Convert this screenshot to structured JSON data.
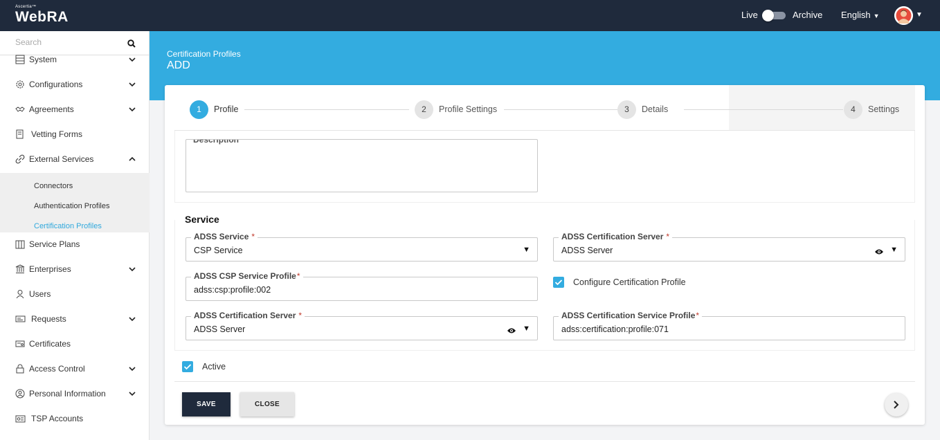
{
  "app": {
    "brand_small": "Ascertia™",
    "name": "WebRA"
  },
  "header": {
    "live_label": "Live",
    "archive_label": "Archive",
    "language": "English",
    "avatar_icon": "user-avatar-icon"
  },
  "sidebar": {
    "search_placeholder": "Search",
    "items": [
      {
        "label": "System",
        "icon": "server-icon",
        "expandable": true
      },
      {
        "label": "Configurations",
        "icon": "gear-icon",
        "expandable": true
      },
      {
        "label": "Agreements",
        "icon": "handshake-icon",
        "expandable": true
      },
      {
        "label": "Vetting Forms",
        "icon": "form-icon",
        "expandable": false
      },
      {
        "label": "External Services",
        "icon": "link-icon",
        "expandable": true,
        "expanded": true
      },
      {
        "label": "Service Plans",
        "icon": "plan-icon",
        "expandable": false
      },
      {
        "label": "Enterprises",
        "icon": "bank-icon",
        "expandable": true
      },
      {
        "label": "Users",
        "icon": "user-icon",
        "expandable": false
      },
      {
        "label": "Requests",
        "icon": "requests-icon",
        "expandable": true
      },
      {
        "label": "Certificates",
        "icon": "certificate-icon",
        "expandable": false
      },
      {
        "label": "Access Control",
        "icon": "lock-icon",
        "expandable": true
      },
      {
        "label": "Personal Information",
        "icon": "person-circle-icon",
        "expandable": true
      },
      {
        "label": "TSP Accounts",
        "icon": "tsp-icon",
        "expandable": false
      }
    ],
    "sub_items": [
      {
        "label": "Connectors",
        "active": false
      },
      {
        "label": "Authentication Profiles",
        "active": false
      },
      {
        "label": "Certification Profiles",
        "active": true
      }
    ]
  },
  "banner": {
    "breadcrumb": "Certification Profiles",
    "title": "ADD"
  },
  "stepper": {
    "steps": [
      {
        "num": "1",
        "label": "Profile",
        "active": true
      },
      {
        "num": "2",
        "label": "Profile Settings",
        "active": false
      },
      {
        "num": "3",
        "label": "Details",
        "active": false
      },
      {
        "num": "4",
        "label": "Settings",
        "active": false
      }
    ]
  },
  "form": {
    "description_label": "Description",
    "service_title": "Service",
    "adss_service": {
      "label": "ADSS Service",
      "value": "CSP Service"
    },
    "adss_cert_server_right": {
      "label": "ADSS Certification Server",
      "value": "ADSS Server"
    },
    "csp_service_profile": {
      "label": "ADSS CSP Service Profile",
      "value": "adss:csp:profile:002"
    },
    "configure_cert_profile": {
      "label": "Configure Certification Profile",
      "checked": true
    },
    "adss_cert_server_left": {
      "label": "ADSS Certification Server",
      "value": "ADSS Server"
    },
    "cert_service_profile": {
      "label": "ADSS Certification Service Profile",
      "value": "adss:certification:profile:071"
    },
    "required_mark": "*",
    "active": {
      "label": "Active",
      "checked": true
    }
  },
  "buttons": {
    "save": "SAVE",
    "close": "CLOSE"
  },
  "colors": {
    "accent": "#33ace0",
    "dark": "#1f2a3c",
    "required": "#c0392b"
  }
}
